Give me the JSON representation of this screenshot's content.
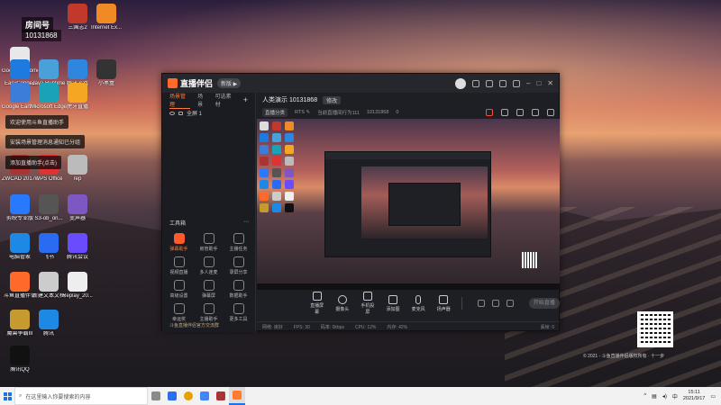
{
  "desktop": {
    "overlay_room": "房间号",
    "overlay_room_no": "10131868",
    "icons": [
      {
        "label": "Google Chrome",
        "color": "#e8e8e8"
      },
      {
        "label": "三国志2",
        "color": "#c0392b"
      },
      {
        "label": "Internet Ex...",
        "color": "#f08a24"
      },
      {
        "label": "EasyConnec",
        "color": "#1f7ae0"
      },
      {
        "label": "Java Runtime",
        "color": "#4aa0d8"
      },
      {
        "label": "腾讯游戏",
        "color": "#2e86de"
      },
      {
        "label": "小黑盒",
        "color": "#333"
      },
      {
        "label": "Google Earth Pro",
        "color": "#3b7dd8"
      },
      {
        "label": "Microsoft Edge",
        "color": "#1aa3b8"
      },
      {
        "label": "虎牙直播",
        "color": "#f5a623"
      },
      {
        "label": "ZWCAD 2017 建筑",
        "color": "#a33"
      },
      {
        "label": "WPS Office",
        "color": "#d33"
      },
      {
        "label": "rep",
        "color": "#bbb"
      },
      {
        "label": "剪映专业版",
        "color": "#2979ff"
      },
      {
        "label": "S3-ob_on...",
        "color": "#555"
      },
      {
        "label": "变声器",
        "color": "#7e57c2"
      },
      {
        "label": "电脑管家",
        "color": "#1e88e5"
      },
      {
        "label": "飞书",
        "color": "#2a6bf2"
      },
      {
        "label": "腾讯会议",
        "color": "#6a4cff"
      },
      {
        "label": "斗鱼直播伴侣",
        "color": "#ff6a2b"
      },
      {
        "label": "新建文本文档",
        "color": "#ccc"
      },
      {
        "label": "Replay_20...",
        "color": "#eee"
      },
      {
        "label": "魔兽争霸III",
        "color": "#c59b2f"
      },
      {
        "label": "腾讯",
        "color": "#1e88e5"
      },
      {
        "label": "腾讯QQ",
        "color": "#111"
      }
    ],
    "tips": [
      "欢迎使用斗鱼直播助手",
      "安装场景管理消息通知已分组",
      "添加直播助手(点击)"
    ],
    "copyright": "© 2021 - 斗鱼直播伴侣版权所有 · 十一步"
  },
  "app": {
    "brand": "直播伴侣",
    "version_badge": "新版 ▶",
    "left_tabs": [
      "场景管理",
      "场景",
      "可选素材"
    ],
    "scene_item": "全屏 1",
    "tools_title": "工具箱",
    "tools": [
      {
        "label": "弹幕助手",
        "hot": true
      },
      {
        "label": "房管助手",
        "hot": false
      },
      {
        "label": "主播任务",
        "hot": false
      },
      {
        "label": "视频直播",
        "hot": false
      },
      {
        "label": "多人连麦",
        "hot": false
      },
      {
        "label": "录屏分享",
        "hot": false
      },
      {
        "label": "高级设置",
        "hot": false
      },
      {
        "label": "弹幕屏",
        "hot": false
      },
      {
        "label": "数据助手",
        "hot": false
      },
      {
        "label": "幸运奖",
        "hot": false
      },
      {
        "label": "主播助手",
        "hot": false
      },
      {
        "label": "更多工具",
        "hot": false
      }
    ],
    "left_footer": "斗鱼直播伴侣官方交流群",
    "room_title": "人类演示 10131868",
    "room_badge": "修改",
    "sub_pill": "直播分类",
    "sub_rtc": "RTS ✎",
    "sub_info": "当前直播间行为111",
    "sub_room": "10131868",
    "sub_fans": "0",
    "controls": [
      "直播屏幕",
      "摄像头",
      "手机投屏",
      "添加图",
      "麦克风",
      "扬声器"
    ],
    "start_label": "开始直播",
    "status": [
      "网络: 良好",
      "FPS: 30",
      "码率: 0kbps",
      "CPU: 12%",
      "内存: 42%",
      "丢帧: 0"
    ]
  },
  "taskbar": {
    "search_placeholder": "在这里输入你要搜索的内容",
    "time": "15:11",
    "date": "2021/9/17",
    "apps": [
      "#8a8a8a",
      "#2b6cf0",
      "#e6a000",
      "#4285f4",
      "#a33",
      "#ff7a2b"
    ]
  }
}
